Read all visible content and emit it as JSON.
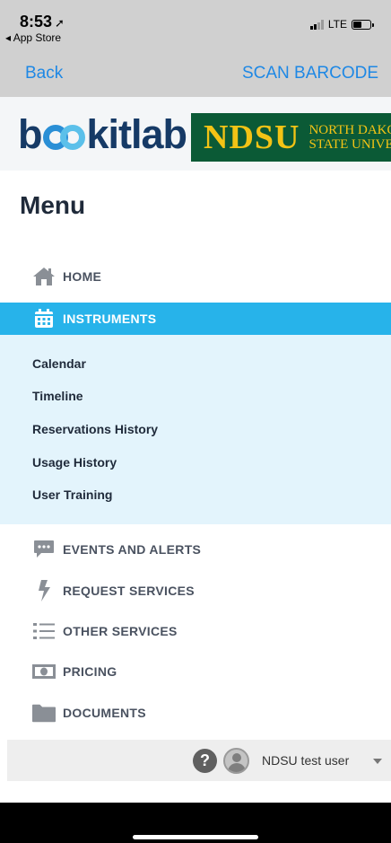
{
  "status_bar": {
    "time": "8:53",
    "location_glyph": "➚",
    "back_app": "◂ App Store",
    "network": "LTE",
    "battery_level": 0.5
  },
  "nav": {
    "back_label": "Back",
    "scan_label": "SCAN BARCODE"
  },
  "brand": {
    "logo_prefix": "b",
    "logo_suffix": "kitlab",
    "ndsu": "NDSU",
    "ndsu_line1": "NORTH DAKO",
    "ndsu_line2": "STATE UNIVE"
  },
  "menu": {
    "title": "Menu",
    "items": [
      {
        "label": "HOME",
        "icon": "home-icon"
      },
      {
        "label": "INSTRUMENTS",
        "icon": "calendar-icon",
        "active": true
      },
      {
        "label": "EVENTS AND ALERTS",
        "icon": "chat-bubble-icon"
      },
      {
        "label": "REQUEST SERVICES",
        "icon": "lightning-icon"
      },
      {
        "label": "OTHER SERVICES",
        "icon": "list-icon"
      },
      {
        "label": "PRICING",
        "icon": "money-icon"
      },
      {
        "label": "DOCUMENTS",
        "icon": "folder-icon"
      }
    ],
    "submenu": [
      "Calendar",
      "Timeline",
      "Reservations History",
      "Usage History",
      "User Training"
    ]
  },
  "user": {
    "name": "NDSU test user",
    "help_glyph": "?"
  },
  "colors": {
    "accent": "#27b3ea",
    "link": "#1e88e5",
    "submenu_bg": "#e3f4fc",
    "ndsu_green": "#0b5a36",
    "ndsu_gold": "#f3c315"
  }
}
